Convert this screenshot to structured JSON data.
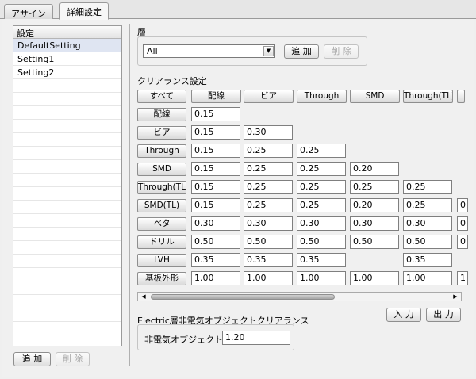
{
  "tabs": [
    {
      "label": "アサイン"
    },
    {
      "label": "詳細設定"
    }
  ],
  "settings_list": {
    "header": "設定",
    "items": [
      "DefaultSetting",
      "Setting1",
      "Setting2"
    ],
    "selected_index": 0
  },
  "list_buttons": {
    "add": "追 加",
    "delete": "削 除"
  },
  "layer": {
    "label": "層",
    "value": "All",
    "add": "追 加",
    "delete": "削 除"
  },
  "clearance": {
    "label": "クリアランス設定",
    "all_button": "すべて",
    "columns": [
      "配線",
      "ビア",
      "Through",
      "SMD",
      "Through(TL)",
      ""
    ],
    "rows": [
      {
        "label": "配線",
        "values": [
          "0.15",
          "",
          "",
          "",
          "",
          ""
        ]
      },
      {
        "label": "ビア",
        "values": [
          "0.15",
          "0.30",
          "",
          "",
          "",
          ""
        ]
      },
      {
        "label": "Through",
        "values": [
          "0.15",
          "0.25",
          "0.25",
          "",
          "",
          ""
        ]
      },
      {
        "label": "SMD",
        "values": [
          "0.15",
          "0.25",
          "0.25",
          "0.20",
          "",
          ""
        ]
      },
      {
        "label": "Through(TL)",
        "values": [
          "0.15",
          "0.25",
          "0.25",
          "0.25",
          "0.25",
          ""
        ]
      },
      {
        "label": "SMD(TL)",
        "values": [
          "0.15",
          "0.25",
          "0.25",
          "0.20",
          "0.25",
          "0"
        ]
      },
      {
        "label": "ベタ",
        "values": [
          "0.30",
          "0.30",
          "0.30",
          "0.30",
          "0.30",
          "0"
        ]
      },
      {
        "label": "ドリル",
        "values": [
          "0.50",
          "0.50",
          "0.50",
          "0.50",
          "0.50",
          "0"
        ]
      },
      {
        "label": "LVH",
        "values": [
          "0.35",
          "0.35",
          "0.35",
          "",
          "0.35",
          ""
        ]
      },
      {
        "label": "基板外形",
        "values": [
          "1.00",
          "1.00",
          "1.00",
          "1.00",
          "1.00",
          "1"
        ]
      }
    ]
  },
  "electric": {
    "label": "Electric層非電気オブジェクトクリアランス",
    "field_label": "非電気オブジェクト",
    "value": "1.20"
  },
  "action_buttons": {
    "input": "入 力",
    "output": "出 力"
  },
  "icons": {
    "combo_arrow": "triangle-down",
    "scroll_left": "triangle-left",
    "scroll_right": "triangle-right"
  }
}
